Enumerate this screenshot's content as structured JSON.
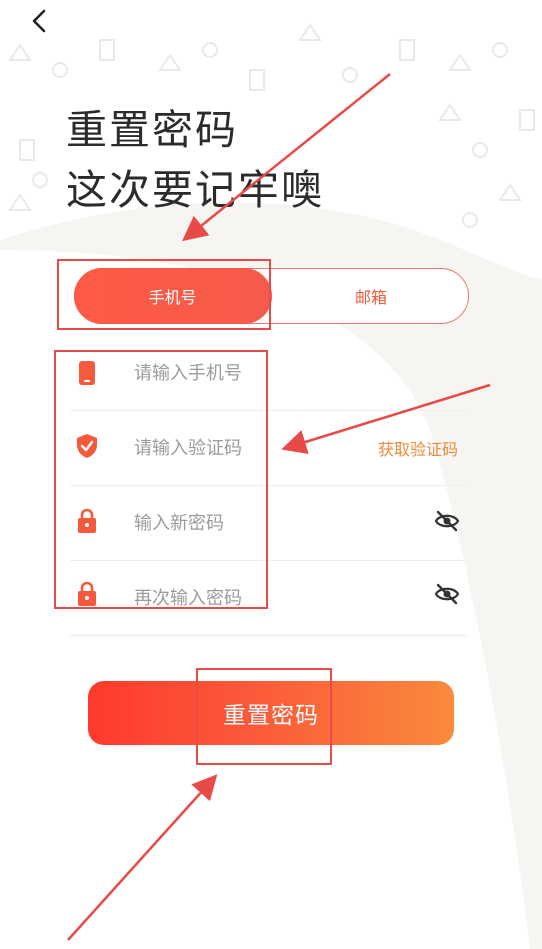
{
  "header": {
    "back_icon": "chevron-left-icon"
  },
  "title": {
    "line1": "重置密码",
    "line2": "这次要记牢噢"
  },
  "tabs": [
    {
      "label": "手机号",
      "active": true
    },
    {
      "label": "邮箱",
      "active": false
    }
  ],
  "form": {
    "phone": {
      "placeholder": "请输入手机号",
      "value": "",
      "icon": "phone-icon"
    },
    "code": {
      "placeholder": "请输入验证码",
      "value": "",
      "icon": "shield-check-icon",
      "action_label": "获取验证码"
    },
    "new_password": {
      "placeholder": "输入新密码",
      "value": "",
      "icon": "lock-icon",
      "toggle_icon": "eye-off-icon"
    },
    "confirm_password": {
      "placeholder": "再次输入密码",
      "value": "",
      "icon": "lock-icon",
      "toggle_icon": "eye-off-icon"
    }
  },
  "submit": {
    "label": "重置密码"
  },
  "colors": {
    "accent": "#f55a4a",
    "accent_orange": "#f98a3c",
    "link": "#f0893a",
    "annotation": "#e84a47",
    "title": "#2b2b2b",
    "placeholder": "#9b9b9b"
  }
}
